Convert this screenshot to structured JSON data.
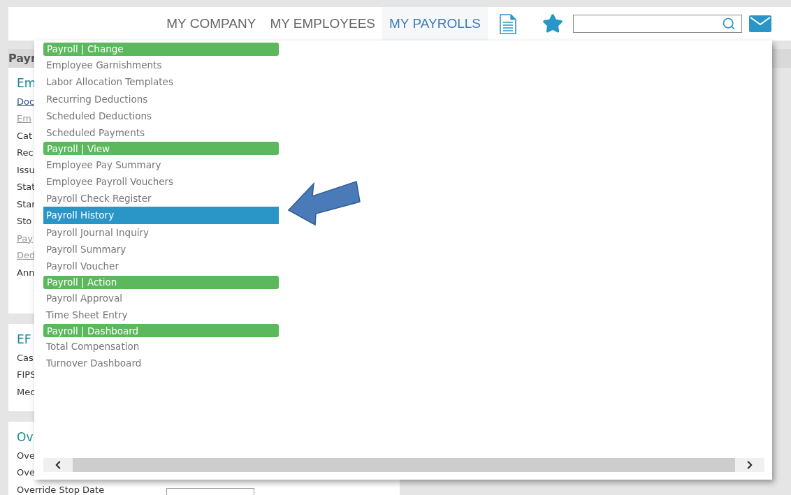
{
  "nav": [
    {
      "label": "MY COMPANY",
      "selected": false
    },
    {
      "label": "MY EMPLOYEES",
      "selected": false
    },
    {
      "label": "MY PAYROLLS",
      "selected": true
    }
  ],
  "page": {
    "section_title": "Payr",
    "cards": [
      {
        "title": "Em",
        "rows": [
          {
            "text": "Doc",
            "kind": "link"
          },
          {
            "text": "Em",
            "kind": "disabled-link"
          },
          {
            "text": "Cat",
            "kind": "label"
          },
          {
            "text": "Rec",
            "kind": "label"
          },
          {
            "text": "Issu",
            "kind": "label"
          },
          {
            "text": "Stat",
            "kind": "label"
          },
          {
            "text": "Star",
            "kind": "label"
          },
          {
            "text": "Sto",
            "kind": "label"
          },
          {
            "text": "Pay",
            "kind": "disabled-link"
          },
          {
            "text": "Ded",
            "kind": "disabled-link"
          },
          {
            "text": "Ann",
            "kind": "label"
          }
        ]
      },
      {
        "title": "EF",
        "rows": [
          {
            "text": "Cas",
            "kind": "label"
          },
          {
            "text": "FIPS",
            "kind": "label"
          },
          {
            "text": "Mec",
            "kind": "label"
          }
        ]
      },
      {
        "title": "Ov",
        "rows": [
          {
            "text": "Ove",
            "kind": "label"
          },
          {
            "text": "Ove",
            "kind": "label"
          },
          {
            "text": "Override Stop Date",
            "kind": "field"
          }
        ]
      }
    ]
  },
  "menu": {
    "sections": [
      {
        "header": "Payroll | Change",
        "items": [
          {
            "label": "Employee Garnishments",
            "selected": false
          },
          {
            "label": "Labor Allocation Templates",
            "selected": false
          },
          {
            "label": "Recurring Deductions",
            "selected": false
          },
          {
            "label": "Scheduled Deductions",
            "selected": false
          },
          {
            "label": "Scheduled Payments",
            "selected": false
          }
        ]
      },
      {
        "header": "Payroll | View",
        "items": [
          {
            "label": "Employee Pay Summary",
            "selected": false
          },
          {
            "label": "Employee Payroll Vouchers",
            "selected": false
          },
          {
            "label": "Payroll Check Register",
            "selected": false
          },
          {
            "label": "Payroll History",
            "selected": true
          },
          {
            "label": "Payroll Journal Inquiry",
            "selected": false
          },
          {
            "label": "Payroll Summary",
            "selected": false
          },
          {
            "label": "Payroll Voucher",
            "selected": false
          }
        ]
      },
      {
        "header": "Payroll | Action",
        "items": [
          {
            "label": "Payroll Approval",
            "selected": false
          },
          {
            "label": "Time Sheet Entry",
            "selected": false
          }
        ]
      },
      {
        "header": "Payroll | Dashboard",
        "items": [
          {
            "label": "Total Compensation",
            "selected": false
          },
          {
            "label": "Turnover Dashboard",
            "selected": false
          }
        ]
      }
    ]
  }
}
